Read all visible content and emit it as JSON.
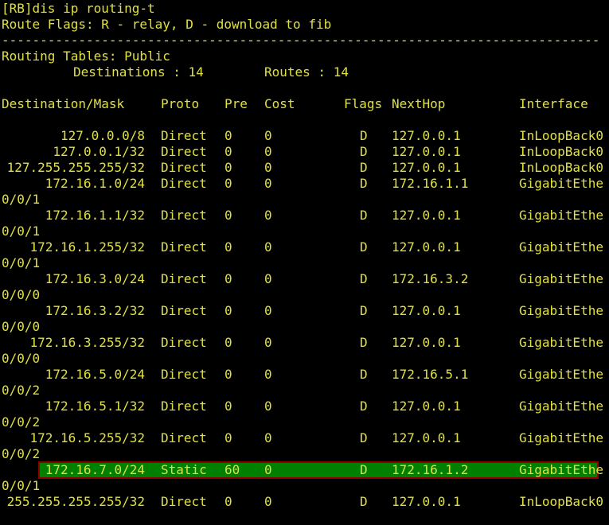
{
  "terminal": {
    "prompt_line": "[RB]dis ip routing-t",
    "flags_line": "Route Flags: R - relay, D - download to fib",
    "separator": "------------------------------------------------------------------------------",
    "table_name": "Routing Tables: Public",
    "dest_label": "Destinations : 14",
    "routes_label": "Routes : 14",
    "headers": {
      "destination": "Destination/Mask",
      "proto": "Proto",
      "pre": "Pre",
      "cost": "Cost",
      "flags": "Flags",
      "nexthop": "NextHop",
      "interface": "Interface"
    },
    "routes": [
      {
        "dest": "127.0.0.0/8",
        "proto": "Direct",
        "pre": "0",
        "cost": "0",
        "flags": "D",
        "nexthop": "127.0.0.1",
        "iface": "InLoopBack0",
        "iface_cont": ""
      },
      {
        "dest": "127.0.0.1/32",
        "proto": "Direct",
        "pre": "0",
        "cost": "0",
        "flags": "D",
        "nexthop": "127.0.0.1",
        "iface": "InLoopBack0",
        "iface_cont": ""
      },
      {
        "dest": "127.255.255.255/32",
        "proto": "Direct",
        "pre": "0",
        "cost": "0",
        "flags": "D",
        "nexthop": "127.0.0.1",
        "iface": "InLoopBack0",
        "iface_cont": ""
      },
      {
        "dest": "172.16.1.0/24",
        "proto": "Direct",
        "pre": "0",
        "cost": "0",
        "flags": "D",
        "nexthop": "172.16.1.1",
        "iface": "GigabitEthe",
        "iface_cont": "0/0/1"
      },
      {
        "dest": "172.16.1.1/32",
        "proto": "Direct",
        "pre": "0",
        "cost": "0",
        "flags": "D",
        "nexthop": "127.0.0.1",
        "iface": "GigabitEthe",
        "iface_cont": "0/0/1"
      },
      {
        "dest": "172.16.1.255/32",
        "proto": "Direct",
        "pre": "0",
        "cost": "0",
        "flags": "D",
        "nexthop": "127.0.0.1",
        "iface": "GigabitEthe",
        "iface_cont": "0/0/1"
      },
      {
        "dest": "172.16.3.0/24",
        "proto": "Direct",
        "pre": "0",
        "cost": "0",
        "flags": "D",
        "nexthop": "172.16.3.2",
        "iface": "GigabitEthe",
        "iface_cont": "0/0/0"
      },
      {
        "dest": "172.16.3.2/32",
        "proto": "Direct",
        "pre": "0",
        "cost": "0",
        "flags": "D",
        "nexthop": "127.0.0.1",
        "iface": "GigabitEthe",
        "iface_cont": "0/0/0"
      },
      {
        "dest": "172.16.3.255/32",
        "proto": "Direct",
        "pre": "0",
        "cost": "0",
        "flags": "D",
        "nexthop": "127.0.0.1",
        "iface": "GigabitEthe",
        "iface_cont": "0/0/0"
      },
      {
        "dest": "172.16.5.0/24",
        "proto": "Direct",
        "pre": "0",
        "cost": "0",
        "flags": "D",
        "nexthop": "172.16.5.1",
        "iface": "GigabitEthe",
        "iface_cont": "0/0/2"
      },
      {
        "dest": "172.16.5.1/32",
        "proto": "Direct",
        "pre": "0",
        "cost": "0",
        "flags": "D",
        "nexthop": "127.0.0.1",
        "iface": "GigabitEthe",
        "iface_cont": "0/0/2"
      },
      {
        "dest": "172.16.5.255/32",
        "proto": "Direct",
        "pre": "0",
        "cost": "0",
        "flags": "D",
        "nexthop": "127.0.0.1",
        "iface": "GigabitEthe",
        "iface_cont": "0/0/2"
      },
      {
        "dest": "172.16.7.0/24",
        "proto": "Static",
        "pre": "60",
        "cost": "0",
        "flags": "D",
        "nexthop": "172.16.1.2",
        "iface": "GigabitEthe",
        "iface_cont": "0/0/1",
        "highlighted": true
      },
      {
        "dest": "255.255.255.255/32",
        "proto": "Direct",
        "pre": "0",
        "cost": "0",
        "flags": "D",
        "nexthop": "127.0.0.1",
        "iface": "InLoopBack0",
        "iface_cont": ""
      }
    ]
  },
  "colors": {
    "background": "#000000",
    "text": "#e0e040",
    "highlight_fill": "#008000",
    "highlight_border": "#8b0000"
  }
}
